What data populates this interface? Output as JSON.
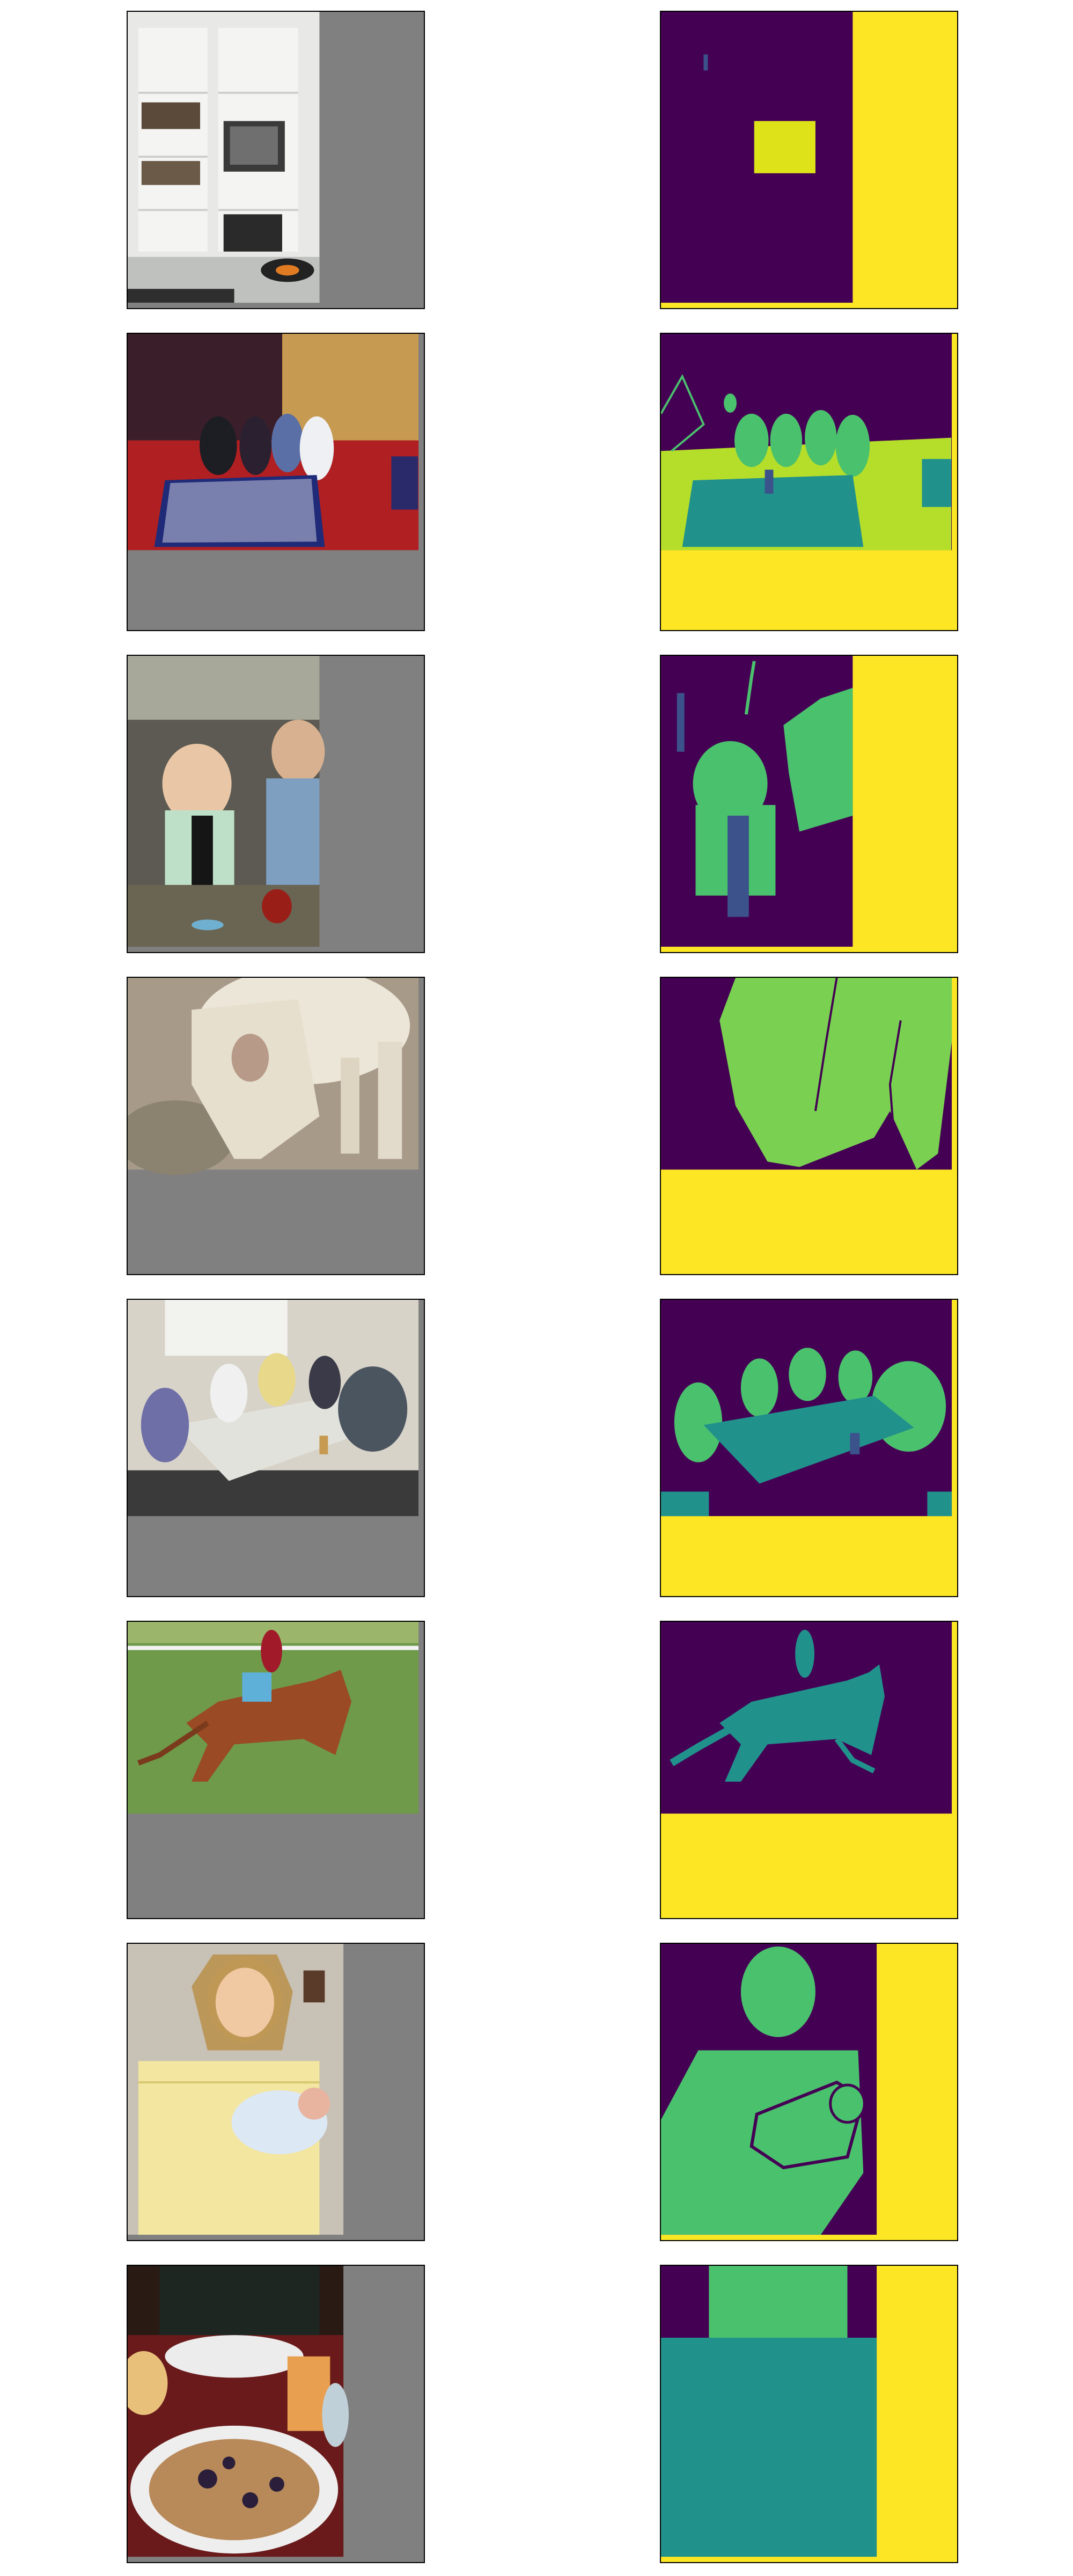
{
  "layout": "grid-8x2",
  "columns": [
    "input-image",
    "segmentation-mask"
  ],
  "colors": {
    "padding_gray": "#808080",
    "mask_background": "#440154",
    "mask_padding": "#fde725",
    "class_light_green": "#7ad151",
    "class_green": "#4ac16d",
    "class_teal": "#21918c",
    "class_lime": "#dde318",
    "class_blue": "#3b528b",
    "class_yellow_green": "#b5de2b"
  },
  "rows": [
    {
      "image": "shelving-unit-with-tv-and-books",
      "mask_classes": [
        "background",
        "tv",
        "padding"
      ]
    },
    {
      "image": "restaurant-group-at-checkered-table",
      "mask_classes": [
        "background",
        "person",
        "dining-table",
        "bottle",
        "couch",
        "plant",
        "padding"
      ]
    },
    {
      "image": "baby-with-champagne-bottle",
      "mask_classes": [
        "background",
        "person",
        "bottle",
        "plant",
        "padding"
      ]
    },
    {
      "image": "sheep-grazing",
      "mask_classes": [
        "background",
        "sheep",
        "padding"
      ]
    },
    {
      "image": "people-around-conference-table",
      "mask_classes": [
        "background",
        "person",
        "dining-table",
        "bottle",
        "chair",
        "padding"
      ]
    },
    {
      "image": "jockey-on-racehorse",
      "mask_classes": [
        "background",
        "person",
        "horse",
        "padding"
      ]
    },
    {
      "image": "woman-holding-baby",
      "mask_classes": [
        "background",
        "person",
        "padding"
      ]
    },
    {
      "image": "pancake-breakfast-table",
      "mask_classes": [
        "background",
        "person",
        "dining-table",
        "padding"
      ]
    }
  ]
}
